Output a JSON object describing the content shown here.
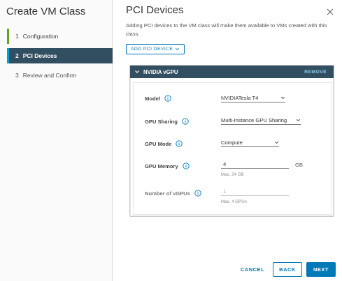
{
  "wizard": {
    "title": "Create VM Class",
    "steps": [
      {
        "num": "1",
        "label": "Configuration",
        "state": "done"
      },
      {
        "num": "2",
        "label": "PCI Devices",
        "state": "active"
      },
      {
        "num": "3",
        "label": "Review and Confirm",
        "state": "todo"
      }
    ]
  },
  "page": {
    "title": "PCI Devices",
    "description": "Adding PCI devices to the VM class will make them available to VMs created with this class.",
    "add_button_label": "ADD PCI DEVICE"
  },
  "device": {
    "title": "NVIDIA vGPU",
    "remove_label": "REMOVE",
    "fields": {
      "model": {
        "label": "Model",
        "value": "NVIDIATesla T4"
      },
      "gpu_sharing": {
        "label": "GPU Sharing",
        "value": "Multi-Instance GPU Sharing"
      },
      "gpu_mode": {
        "label": "GPU Mode",
        "value": "Compute"
      },
      "gpu_memory": {
        "label": "GPU Memory",
        "value": "4",
        "unit": "GB",
        "help": "Max. 24 GB"
      },
      "num_vgpus": {
        "label": "Number of vGPUs",
        "value": "1",
        "help": "Max. 4 GPUs"
      }
    }
  },
  "footer": {
    "cancel_label": "CANCEL",
    "back_label": "BACK",
    "next_label": "NEXT"
  },
  "colors": {
    "primary": "#0079b8",
    "header_dark": "#324f61",
    "step_done": "#62a420",
    "step_active_accent": "#00a1db"
  },
  "icons": [
    "close-icon",
    "chevron-down-icon",
    "info-icon",
    "collapse-chevron-icon"
  ]
}
